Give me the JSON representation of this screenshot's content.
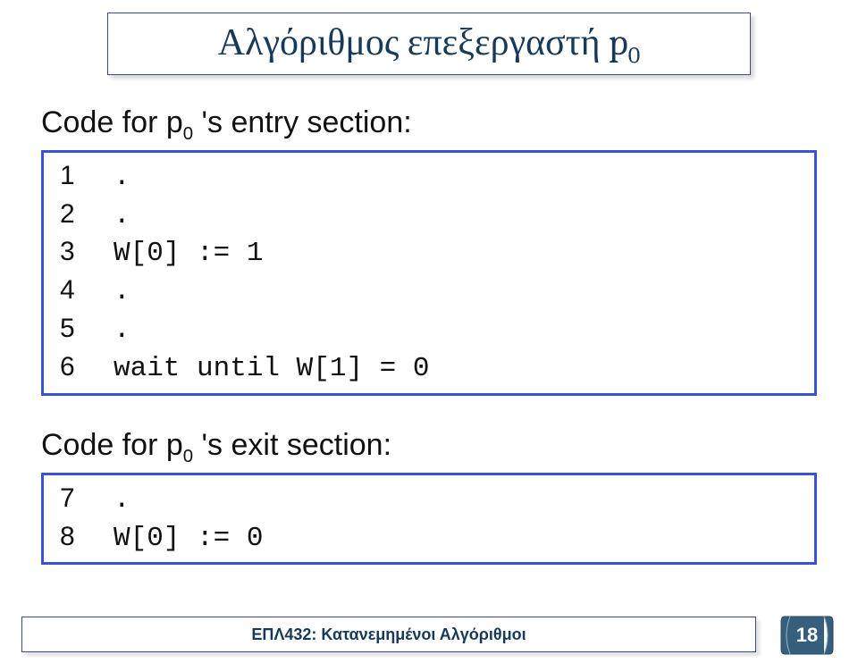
{
  "title": {
    "main_html_prefix": "Αλγόριθμος επεξεργαστή p",
    "main_sub": "0"
  },
  "entry": {
    "heading_prefix": "Code for p",
    "heading_sub": "0",
    "heading_suffix": " 's entry section:",
    "lines": [
      {
        "n": "1",
        "code": "."
      },
      {
        "n": "2",
        "code": "."
      },
      {
        "n": "3",
        "code": "W[0] := 1"
      },
      {
        "n": "4",
        "code": "."
      },
      {
        "n": "5",
        "code": "."
      },
      {
        "n": "6",
        "code": "wait until W[1] = 0"
      }
    ]
  },
  "exit": {
    "heading_prefix": "Code for p",
    "heading_sub": "0",
    "heading_suffix": " 's exit section:",
    "lines": [
      {
        "n": "7",
        "code": "."
      },
      {
        "n": "8",
        "code": "W[0] := 0"
      }
    ]
  },
  "footer": {
    "text": "ΕΠΛ432: Κατανεμημένοι Αλγόριθμοι",
    "page": "18"
  }
}
